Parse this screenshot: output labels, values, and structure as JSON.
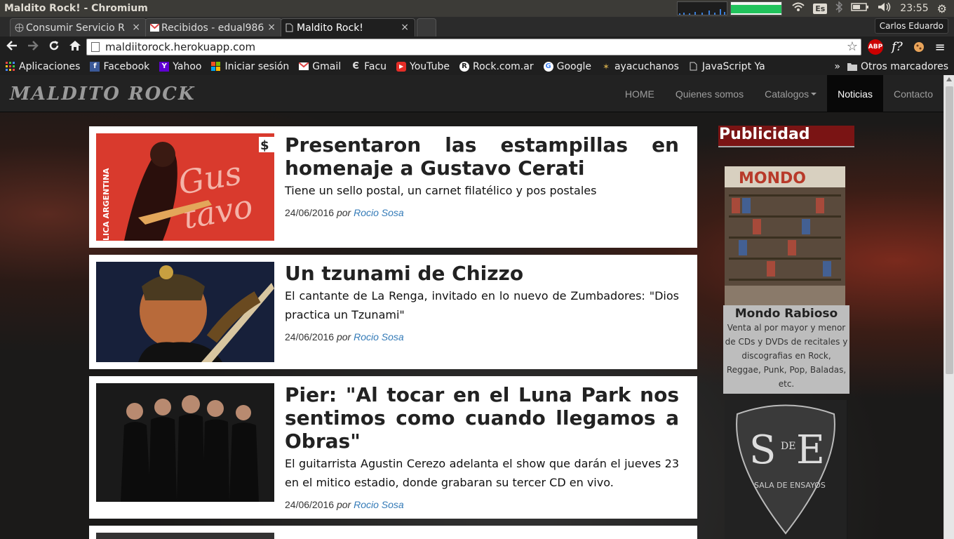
{
  "os": {
    "window_title": "Maldito Rock! - Chromium",
    "keyboard": "Es",
    "time": "23:55"
  },
  "tabs": [
    {
      "label": "Consumir Servicio R",
      "icon": "web-icon"
    },
    {
      "label": "Recibidos - edual986",
      "icon": "gmail-icon"
    },
    {
      "label": "Maldito Rock!",
      "icon": "page-icon"
    }
  ],
  "profile": {
    "name": "Carlos Eduardo"
  },
  "toolbar": {
    "url": "maldiitorock.herokuapp.com",
    "ext_abp": "ABP",
    "ext_f": "f?"
  },
  "bookmarks": {
    "items": [
      {
        "label": "Aplicaciones",
        "icon": "apps-icon"
      },
      {
        "label": "Facebook",
        "icon": "facebook-icon"
      },
      {
        "label": "Yahoo",
        "icon": "yahoo-icon"
      },
      {
        "label": "Iniciar sesión",
        "icon": "microsoft-icon"
      },
      {
        "label": "Gmail",
        "icon": "gmail-icon"
      },
      {
        "label": "Facu",
        "icon": "evernote-icon"
      },
      {
        "label": "YouTube",
        "icon": "youtube-icon"
      },
      {
        "label": "Rock.com.ar",
        "icon": "rock-icon"
      },
      {
        "label": "Google",
        "icon": "google-icon"
      },
      {
        "label": "ayacuchanos",
        "icon": "site-icon"
      },
      {
        "label": "JavaScript Ya",
        "icon": "page-icon"
      }
    ],
    "more": "»",
    "other": "Otros marcadores"
  },
  "site": {
    "logo": "Maldito Rock",
    "nav": [
      "HOME",
      "Quienes somos",
      "Catalogos",
      "Noticias",
      "Contacto"
    ],
    "active_nav": "Noticias"
  },
  "news": [
    {
      "title": "Presentaron las estampillas en homenaje a Gustavo Cerati",
      "summary": "Tiene un sello postal, un carnet filatélico y pos postales",
      "date": "24/06/2016",
      "by": "por",
      "author": "Rocio Sosa"
    },
    {
      "title": "Un tzunami de Chizzo",
      "summary": "El cantante de La Renga, invitado en lo nuevo de Zumbadores: \"Dios practica un Tzunami\"",
      "date": "24/06/2016",
      "by": "por",
      "author": "Rocio Sosa"
    },
    {
      "title": "Pier: \"Al tocar en el Luna Park nos sentimos como cuando llegamos a Obras\"",
      "summary": "El guitarrista Agustin Cerezo adelanta el show que darán el jueves 23 en el mitico estadio, donde grabaran su tercer CD en vivo.",
      "date": "24/06/2016",
      "by": "por",
      "author": "Rocio Sosa"
    }
  ],
  "sidebar": {
    "heading": "Publicidad",
    "ads": [
      {
        "name": "Mondo Rabioso",
        "description": "Venta al por mayor y menor de CDs y DVDs de recitales y discografias en Rock, Reggae, Punk, Pop, Baladas, etc."
      },
      {
        "name": "S de E",
        "sub": "SALA DE ENSAYOS"
      }
    ]
  }
}
